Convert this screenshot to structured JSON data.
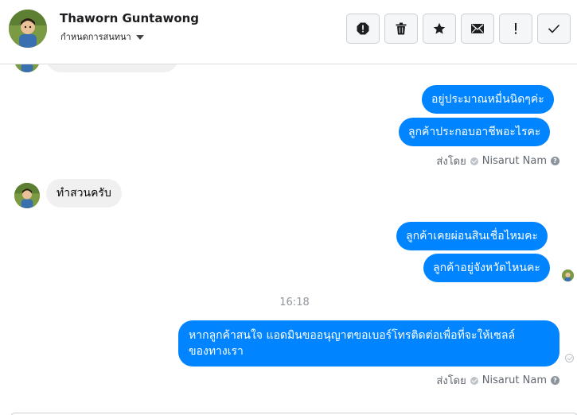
{
  "header": {
    "contact_name": "Thaworn Guntawong",
    "conversation_settings": "กำหนดการสนทนา",
    "actions": [
      {
        "name": "report-icon",
        "label": "Report"
      },
      {
        "name": "trash-icon",
        "label": "Delete"
      },
      {
        "name": "star-icon",
        "label": "Star"
      },
      {
        "name": "mail-icon",
        "label": "Mark unread"
      },
      {
        "name": "exclamation-icon",
        "label": "Follow up"
      },
      {
        "name": "checkmark-icon",
        "label": "Done"
      }
    ]
  },
  "messages": {
    "out_1": "อยู่ประมาณหมื่นนิดๆค่ะ",
    "out_2": "ลูกค้าประกอบอาชีพอะไรคะ",
    "sent_by_1": {
      "prefix": "ส่งโดย",
      "name": "Nisarut Nam"
    },
    "in_1": "ทำสวนครับ",
    "out_3": "ลูกค้าเคยผ่อนสินเชื่อไหมคะ",
    "out_4": "ลูกค้าอยู่จังหวัดไหนคะ",
    "time": "16:18",
    "out_5_line1": "หากลูกค้าสนใจ แอดมินขออนุญาตขอเบอร์โทรติดต่อเพื่อที่จะให้เซลล์",
    "out_5_line2": "ของทางเรา",
    "sent_by_2": {
      "prefix": "ส่งโดย",
      "name": "Nisarut Nam"
    }
  },
  "colors": {
    "outgoing_bubble": "#0084ff",
    "incoming_bubble": "#f1f0f0",
    "meta_text": "#606770"
  }
}
